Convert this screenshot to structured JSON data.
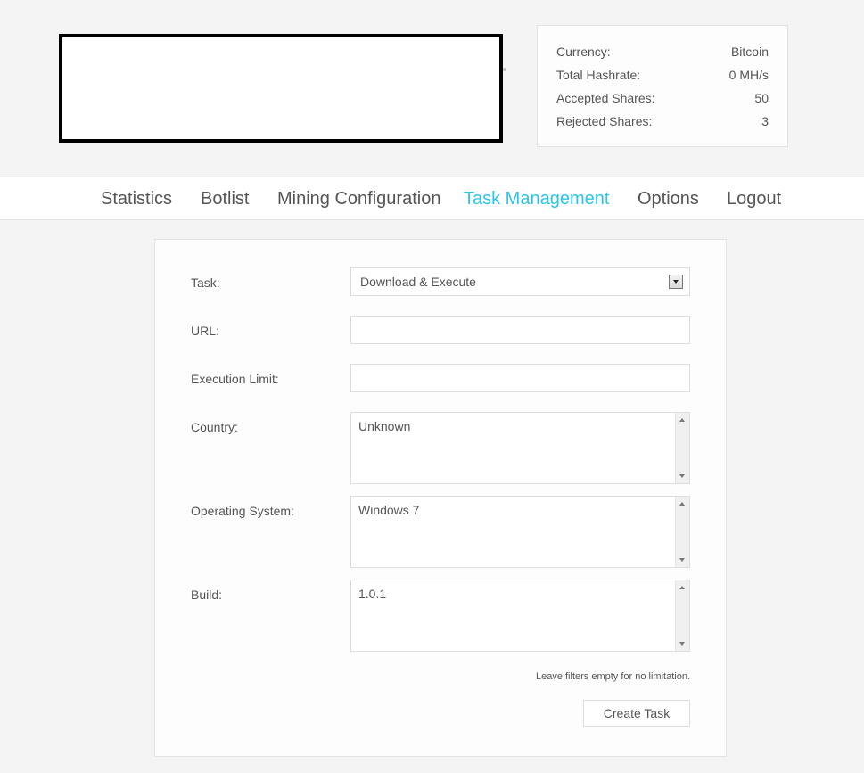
{
  "stats": {
    "currency_label": "Currency:",
    "currency_value": "Bitcoin",
    "hashrate_label": "Total Hashrate:",
    "hashrate_value": "0 MH/s",
    "accepted_label": "Accepted Shares:",
    "accepted_value": "50",
    "rejected_label": "Rejected Shares:",
    "rejected_value": "3"
  },
  "nav": {
    "items": [
      {
        "label": "Statistics"
      },
      {
        "label": "Botlist"
      },
      {
        "label": "Mining Configuration"
      },
      {
        "label": "Task Management"
      },
      {
        "label": "Options"
      },
      {
        "label": "Logout"
      }
    ],
    "active": "Task Management",
    "active_color": "#2ec4e6"
  },
  "form": {
    "task_label": "Task:",
    "task_value": "Download & Execute",
    "url_label": "URL:",
    "url_value": "",
    "limit_label": "Execution Limit:",
    "limit_value": "",
    "country_label": "Country:",
    "country_options": [
      "Unknown"
    ],
    "os_label": "Operating System:",
    "os_options": [
      "Windows 7"
    ],
    "build_label": "Build:",
    "build_options": [
      "1.0.1"
    ],
    "hint": "Leave filters empty for no limitation.",
    "submit_label": "Create Task"
  }
}
